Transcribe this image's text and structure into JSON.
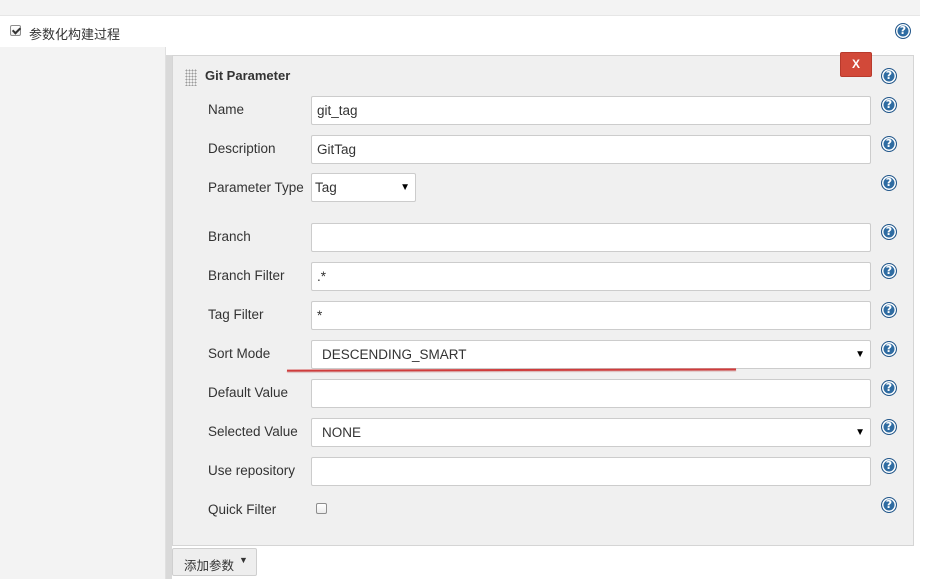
{
  "section": {
    "label": "参数化构建过程",
    "checked": true
  },
  "parameter": {
    "title": "Git Parameter",
    "delete_label": "X",
    "help_glyph": "?",
    "fields": [
      {
        "label": "Name",
        "value": "git_tag"
      },
      {
        "label": "Description",
        "value": "GitTag"
      },
      {
        "label": "Parameter Type",
        "value": "Tag"
      },
      {
        "label": "Branch",
        "value": ""
      },
      {
        "label": "Branch Filter",
        "value": ".*"
      },
      {
        "label": "Tag Filter",
        "value": "*"
      },
      {
        "label": "Sort Mode",
        "value": "DESCENDING_SMART"
      },
      {
        "label": "Default Value",
        "value": ""
      },
      {
        "label": "Selected Value",
        "value": "NONE"
      },
      {
        "label": "Use repository",
        "value": ""
      },
      {
        "label": "Quick Filter",
        "checked": false
      }
    ]
  },
  "add_button": {
    "label": "添加参数",
    "caret": "▼"
  },
  "icons": {
    "help": "help-icon",
    "drag": "drag-handle-icon",
    "dropdown": "chevron-down-icon",
    "checkbox": "checkbox-icon"
  },
  "colors": {
    "accent_help": "#2f6ca2",
    "delete_button": "#d24939",
    "annotation_underline": "#d03c3c",
    "panel_background": "#f0f0f0"
  }
}
